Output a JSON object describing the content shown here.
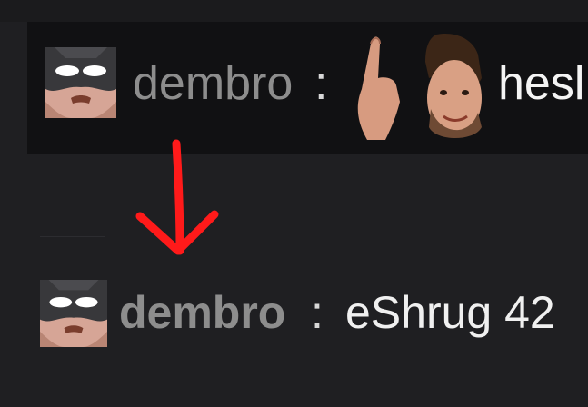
{
  "chat_before": {
    "username": "dembro",
    "separator": ":",
    "emote_icon": "waving-man-emote",
    "message": "hesl"
  },
  "chat_after": {
    "username": "dembro",
    "separator": ":",
    "message": "eShrug 42"
  },
  "annotation": {
    "arrow_icon": "down-arrow-icon",
    "arrow_color": "#ff1a1a"
  },
  "colors": {
    "background": "#1f1f22",
    "chat_highlight": "#111113",
    "username": "#8d8d8d",
    "text": "#f4f4f4"
  }
}
